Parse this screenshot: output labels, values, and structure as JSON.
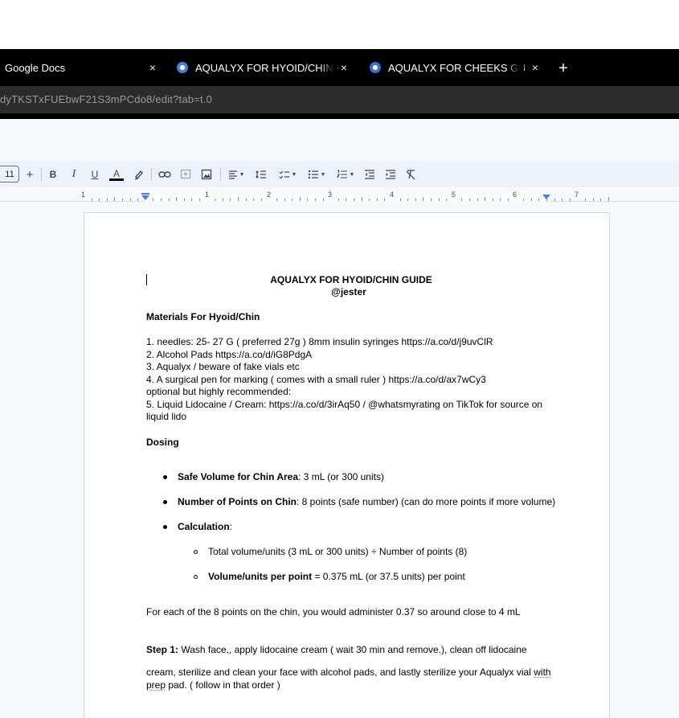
{
  "tabs": [
    {
      "label": "Google Docs",
      "close": "×"
    },
    {
      "label": "AQUALYX FOR HYOID/CHIN + N",
      "close": "×"
    },
    {
      "label": "AQUALYX FOR CHEEKS GUIDE -",
      "close": "×"
    }
  ],
  "new_tab": "+",
  "address": "dyTKSTxFUEbwF21S3mPCdo8/edit?tab=t.0",
  "toolbar": {
    "font_size": "11",
    "increase": "+",
    "bold": "B",
    "italic": "I",
    "underline": "U",
    "text_color": "A"
  },
  "ruler": {
    "numbers": [
      "1",
      "1",
      "2",
      "3",
      "4",
      "5",
      "6",
      "7"
    ]
  },
  "document": {
    "title": "AQUALYX FOR HYOID/CHIN GUIDE",
    "author": "@jester",
    "materials_heading": "Materials For Hyoid/Chin",
    "materials": [
      "1.  needles: 25- 27 G ( preferred 27g ) 8mm insulin syringes https://a.co/d/j9uvClR",
      "2. Alcohol Pads https://a.co/d/iG8PdgA",
      "3. Aqualyx / beware of fake vials etc",
      "4. A surgical pen for marking ( comes with a small ruler ) https://a.co/d/ax7wCy3",
      "optional but highly recommended:",
      "5. Liquid Lidocaine / Cream: https://a.co/d/3irAq50 / @whatsmyrating on TikTok for source on",
      "liquid lido"
    ],
    "dosing_heading": "Dosing",
    "bullets": [
      {
        "bold": "Safe Volume for Chin Area",
        "rest": ": 3 mL (or 300 units)"
      },
      {
        "bold": "Number of Points on Chin",
        "rest": ": 8 points (safe number) (can do more points if more volume)"
      },
      {
        "bold": "",
        "rest": "Calculation:"
      }
    ],
    "calc_label": "Calculation",
    "calc_rest": ":",
    "sub_bullets": [
      {
        "bold": "",
        "rest": "Total volume/units (3 mL or 300 units) ÷ Number of points (8)"
      },
      {
        "bold": "Volume/units per point",
        "rest": " = 0.375 mL (or 37.5 units) per point"
      }
    ],
    "summary": "For each of the 8 points on the chin, you would administer 0.37 so around close to 4 mL",
    "step1_bold": "Step 1:",
    "step1_rest": " Wash face,, apply lidocaine cream ( wait 30 min and remove.), clean off lidocaine",
    "step1_line2_a": "cream, sterilize and clean your face with alcohol pads, and lastly sterilize your Aqualyx vial ",
    "step1_line2_b": "with",
    "step1_line3_a": "prep",
    "step1_line3_b": " pad. ( follow in that order )"
  },
  "colors": {
    "tabbar": "#000000",
    "addressbar": "#2b2b2b",
    "toolbar": "#edf2fa",
    "accent": "#4a7de0"
  }
}
